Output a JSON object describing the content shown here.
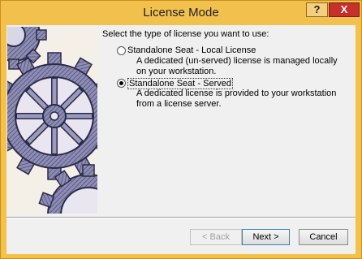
{
  "window": {
    "title": "License Mode",
    "help_label": "?",
    "close_label": "X"
  },
  "content": {
    "prompt": "Select the type of license you want to use:",
    "options": [
      {
        "label": "Standalone Seat - Local License",
        "description": "A dedicated (un-served) license is managed locally on your workstation.",
        "selected": false
      },
      {
        "label": "Standalone Seat - Served",
        "description": "A dedicated license is provided to your workstation from a license server.",
        "selected": true
      }
    ]
  },
  "buttons": {
    "back": "< Back",
    "next": "Next >",
    "cancel": "Cancel"
  },
  "colors": {
    "titlebar": "#f2c14d",
    "close": "#c7312b",
    "gear": "#6b6b96"
  },
  "icons": {
    "illustration": "gears-illustration"
  }
}
